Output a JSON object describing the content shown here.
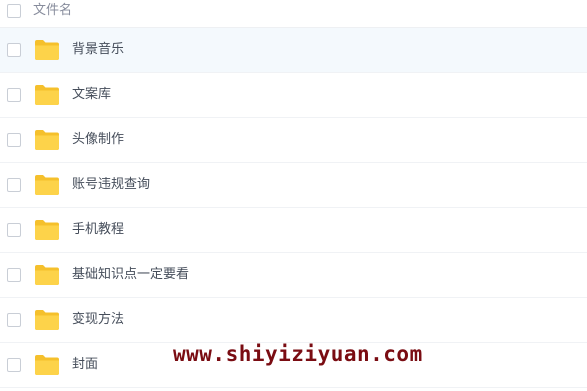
{
  "header": {
    "column_label": "文件名"
  },
  "files": [
    {
      "name": "背景音乐"
    },
    {
      "name": "文案库"
    },
    {
      "name": "头像制作"
    },
    {
      "name": "账号违规查询"
    },
    {
      "name": "手机教程"
    },
    {
      "name": "基础知识点一定要看"
    },
    {
      "name": "变现方法"
    },
    {
      "name": "封面"
    }
  ],
  "watermark": {
    "text": "www.shiyiziyuan.com"
  },
  "colors": {
    "folder": "#fdd34a",
    "folder_tab": "#f5c02c",
    "active_row": "#f4f9fd",
    "watermark": "#7a0c12"
  }
}
